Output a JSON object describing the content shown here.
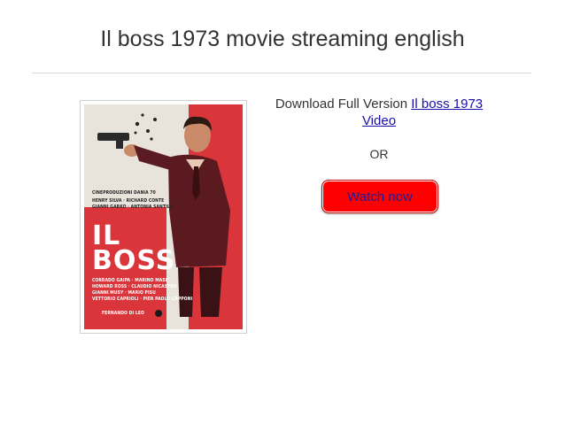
{
  "page": {
    "title": "Il boss 1973 movie streaming english"
  },
  "poster": {
    "credit_company": "CINEPRODUZIONI DANIA 70",
    "cast_top": [
      "HENRY SILVA · RICHARD CONTE",
      "GIANNI GARKO · ANTONIA SANTILLI"
    ],
    "title": "IL BOSS",
    "title_line1": "IL",
    "title_line2": "BOSS",
    "cast_bottom": [
      "CORRADO GAIPA · MARINO MASE'",
      "HOWARD ROSS · CLAUDIO NICASTRO",
      "GIANNI MUSY · MARIO PISU",
      "VETTORIO CAPRIOLI · PIER PAOLO CAPPONI"
    ],
    "director": "FERNANDO DI LEO",
    "colors": {
      "red": "#d9353a",
      "background": "#e8e4dc"
    }
  },
  "download": {
    "prefix": "Download Full Version ",
    "link_text": "Il boss 1973 Video"
  },
  "or_text": "OR",
  "watch_button": {
    "label": "Watch now",
    "color": "#ff0000"
  }
}
